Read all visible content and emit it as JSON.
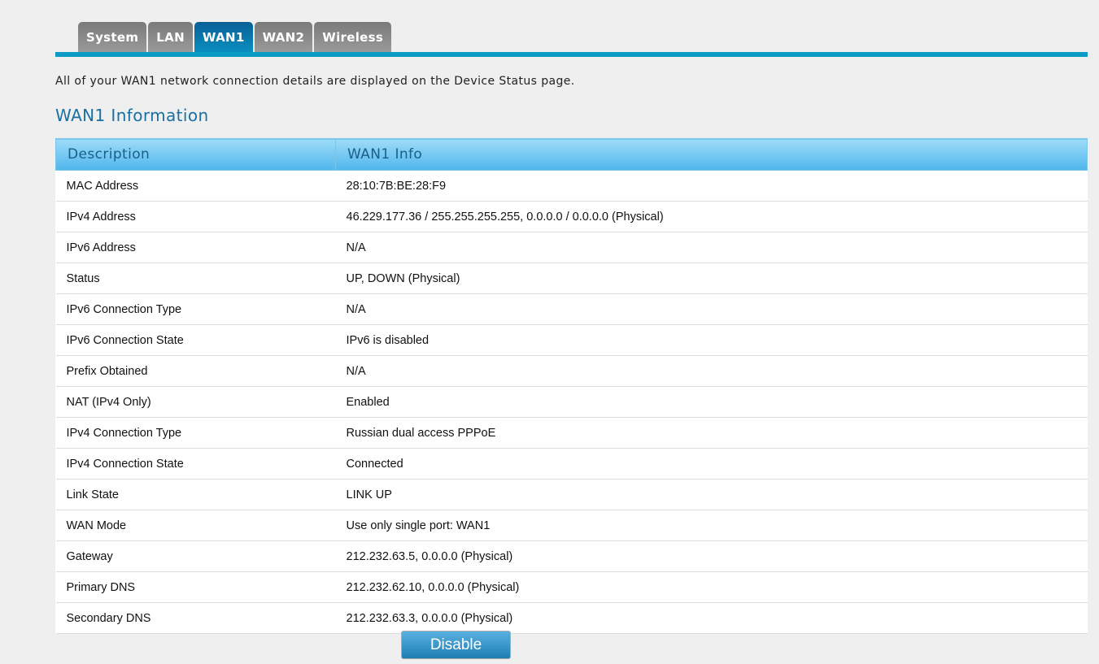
{
  "tabs": [
    {
      "label": "System"
    },
    {
      "label": "LAN"
    },
    {
      "label": "WAN1",
      "active": true
    },
    {
      "label": "WAN2"
    },
    {
      "label": "Wireless"
    }
  ],
  "intro": "All of your WAN1 network connection details are displayed on the Device Status page.",
  "heading": "WAN1 Information",
  "table": {
    "headers": [
      "Description",
      "WAN1 Info"
    ],
    "rows": [
      [
        "MAC Address",
        "28:10:7B:BE:28:F9"
      ],
      [
        "IPv4 Address",
        "46.229.177.36 / 255.255.255.255, 0.0.0.0 / 0.0.0.0 (Physical)"
      ],
      [
        "IPv6 Address",
        "N/A"
      ],
      [
        "Status",
        "UP, DOWN (Physical)"
      ],
      [
        "IPv6 Connection Type",
        "N/A"
      ],
      [
        "IPv6 Connection State",
        "IPv6 is disabled"
      ],
      [
        "Prefix Obtained",
        "N/A"
      ],
      [
        "NAT (IPv4 Only)",
        "Enabled"
      ],
      [
        "IPv4 Connection Type",
        "Russian dual access PPPoE"
      ],
      [
        "IPv4 Connection State",
        "Connected"
      ],
      [
        "Link State",
        "LINK UP"
      ],
      [
        "WAN Mode",
        "Use only single port: WAN1"
      ],
      [
        "Gateway",
        "212.232.63.5, 0.0.0.0 (Physical)"
      ],
      [
        "Primary DNS",
        "212.232.62.10, 0.0.0.0 (Physical)"
      ],
      [
        "Secondary DNS",
        "212.232.63.3, 0.0.0.0 (Physical)"
      ]
    ]
  },
  "button": "Disable"
}
